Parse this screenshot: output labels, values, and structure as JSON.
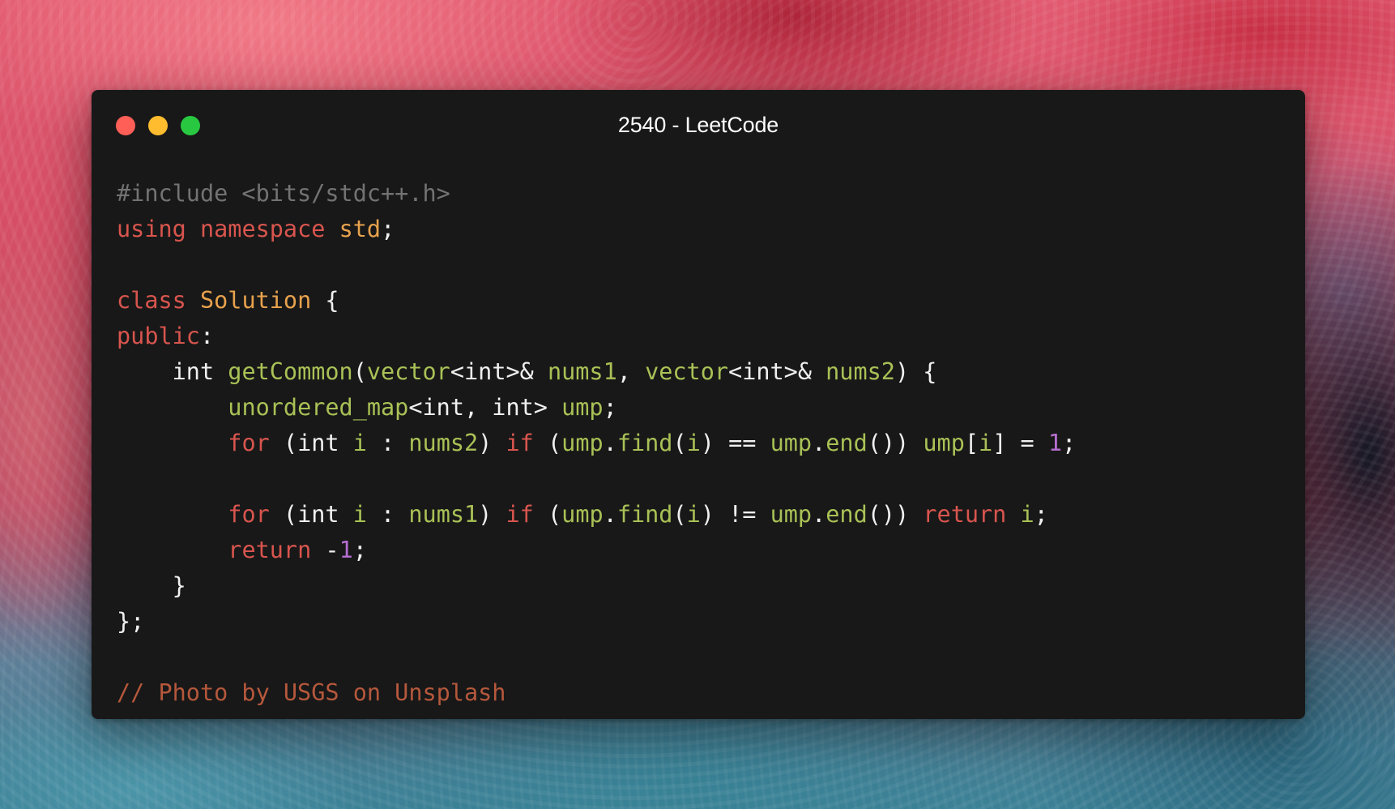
{
  "window": {
    "title": "2540 - LeetCode",
    "traffic_lights": {
      "close_color": "#ff5f57",
      "minimize_color": "#febc2e",
      "maximize_color": "#28c840"
    }
  },
  "editor": {
    "language": "cpp",
    "lines": [
      [
        {
          "t": "#include <bits/stdc++.h>",
          "c": "pre"
        }
      ],
      [
        {
          "t": "using",
          "c": "kw"
        },
        {
          "t": " "
        },
        {
          "t": "namespace",
          "c": "kw"
        },
        {
          "t": " "
        },
        {
          "t": "std",
          "c": "type"
        },
        {
          "t": ";"
        }
      ],
      [],
      [
        {
          "t": "class",
          "c": "kw"
        },
        {
          "t": " "
        },
        {
          "t": "Solution",
          "c": "type"
        },
        {
          "t": " {"
        }
      ],
      [
        {
          "t": "public",
          "c": "kw"
        },
        {
          "t": ":"
        }
      ],
      [
        {
          "t": "    int "
        },
        {
          "t": "getCommon",
          "c": "fn"
        },
        {
          "t": "("
        },
        {
          "t": "vector",
          "c": "fn"
        },
        {
          "t": "<int>& "
        },
        {
          "t": "nums1",
          "c": "fn"
        },
        {
          "t": ", "
        },
        {
          "t": "vector",
          "c": "fn"
        },
        {
          "t": "<int>& "
        },
        {
          "t": "nums2",
          "c": "fn"
        },
        {
          "t": ") {"
        }
      ],
      [
        {
          "t": "        "
        },
        {
          "t": "unordered_map",
          "c": "fn"
        },
        {
          "t": "<int, int> "
        },
        {
          "t": "ump",
          "c": "fn"
        },
        {
          "t": ";"
        }
      ],
      [
        {
          "t": "        "
        },
        {
          "t": "for",
          "c": "kw"
        },
        {
          "t": " (int "
        },
        {
          "t": "i",
          "c": "fn"
        },
        {
          "t": " : "
        },
        {
          "t": "nums2",
          "c": "fn"
        },
        {
          "t": ") "
        },
        {
          "t": "if",
          "c": "kw"
        },
        {
          "t": " ("
        },
        {
          "t": "ump",
          "c": "fn"
        },
        {
          "t": "."
        },
        {
          "t": "find",
          "c": "fn"
        },
        {
          "t": "("
        },
        {
          "t": "i",
          "c": "fn"
        },
        {
          "t": ") == "
        },
        {
          "t": "ump",
          "c": "fn"
        },
        {
          "t": "."
        },
        {
          "t": "end",
          "c": "fn"
        },
        {
          "t": "()) "
        },
        {
          "t": "ump",
          "c": "fn"
        },
        {
          "t": "["
        },
        {
          "t": "i",
          "c": "fn"
        },
        {
          "t": "] = "
        },
        {
          "t": "1",
          "c": "num"
        },
        {
          "t": ";"
        }
      ],
      [],
      [
        {
          "t": "        "
        },
        {
          "t": "for",
          "c": "kw"
        },
        {
          "t": " (int "
        },
        {
          "t": "i",
          "c": "fn"
        },
        {
          "t": " : "
        },
        {
          "t": "nums1",
          "c": "fn"
        },
        {
          "t": ") "
        },
        {
          "t": "if",
          "c": "kw"
        },
        {
          "t": " ("
        },
        {
          "t": "ump",
          "c": "fn"
        },
        {
          "t": "."
        },
        {
          "t": "find",
          "c": "fn"
        },
        {
          "t": "("
        },
        {
          "t": "i",
          "c": "fn"
        },
        {
          "t": ") != "
        },
        {
          "t": "ump",
          "c": "fn"
        },
        {
          "t": "."
        },
        {
          "t": "end",
          "c": "fn"
        },
        {
          "t": "()) "
        },
        {
          "t": "return",
          "c": "kw"
        },
        {
          "t": " "
        },
        {
          "t": "i",
          "c": "fn"
        },
        {
          "t": ";"
        }
      ],
      [
        {
          "t": "        "
        },
        {
          "t": "return",
          "c": "kw"
        },
        {
          "t": " -"
        },
        {
          "t": "1",
          "c": "num"
        },
        {
          "t": ";"
        }
      ],
      [
        {
          "t": "    }"
        }
      ],
      [
        {
          "t": "};"
        }
      ],
      [],
      [
        {
          "t": "// Photo by USGS on Unsplash",
          "c": "com"
        }
      ]
    ]
  },
  "colors": {
    "window_bg": "#181818",
    "preprocessor": "#737373",
    "keyword": "#d8554e",
    "type": "#e8a24d",
    "plain": "#f0f0f0",
    "identifier": "#a9c156",
    "number": "#b66fd1",
    "comment": "#b5583c"
  }
}
